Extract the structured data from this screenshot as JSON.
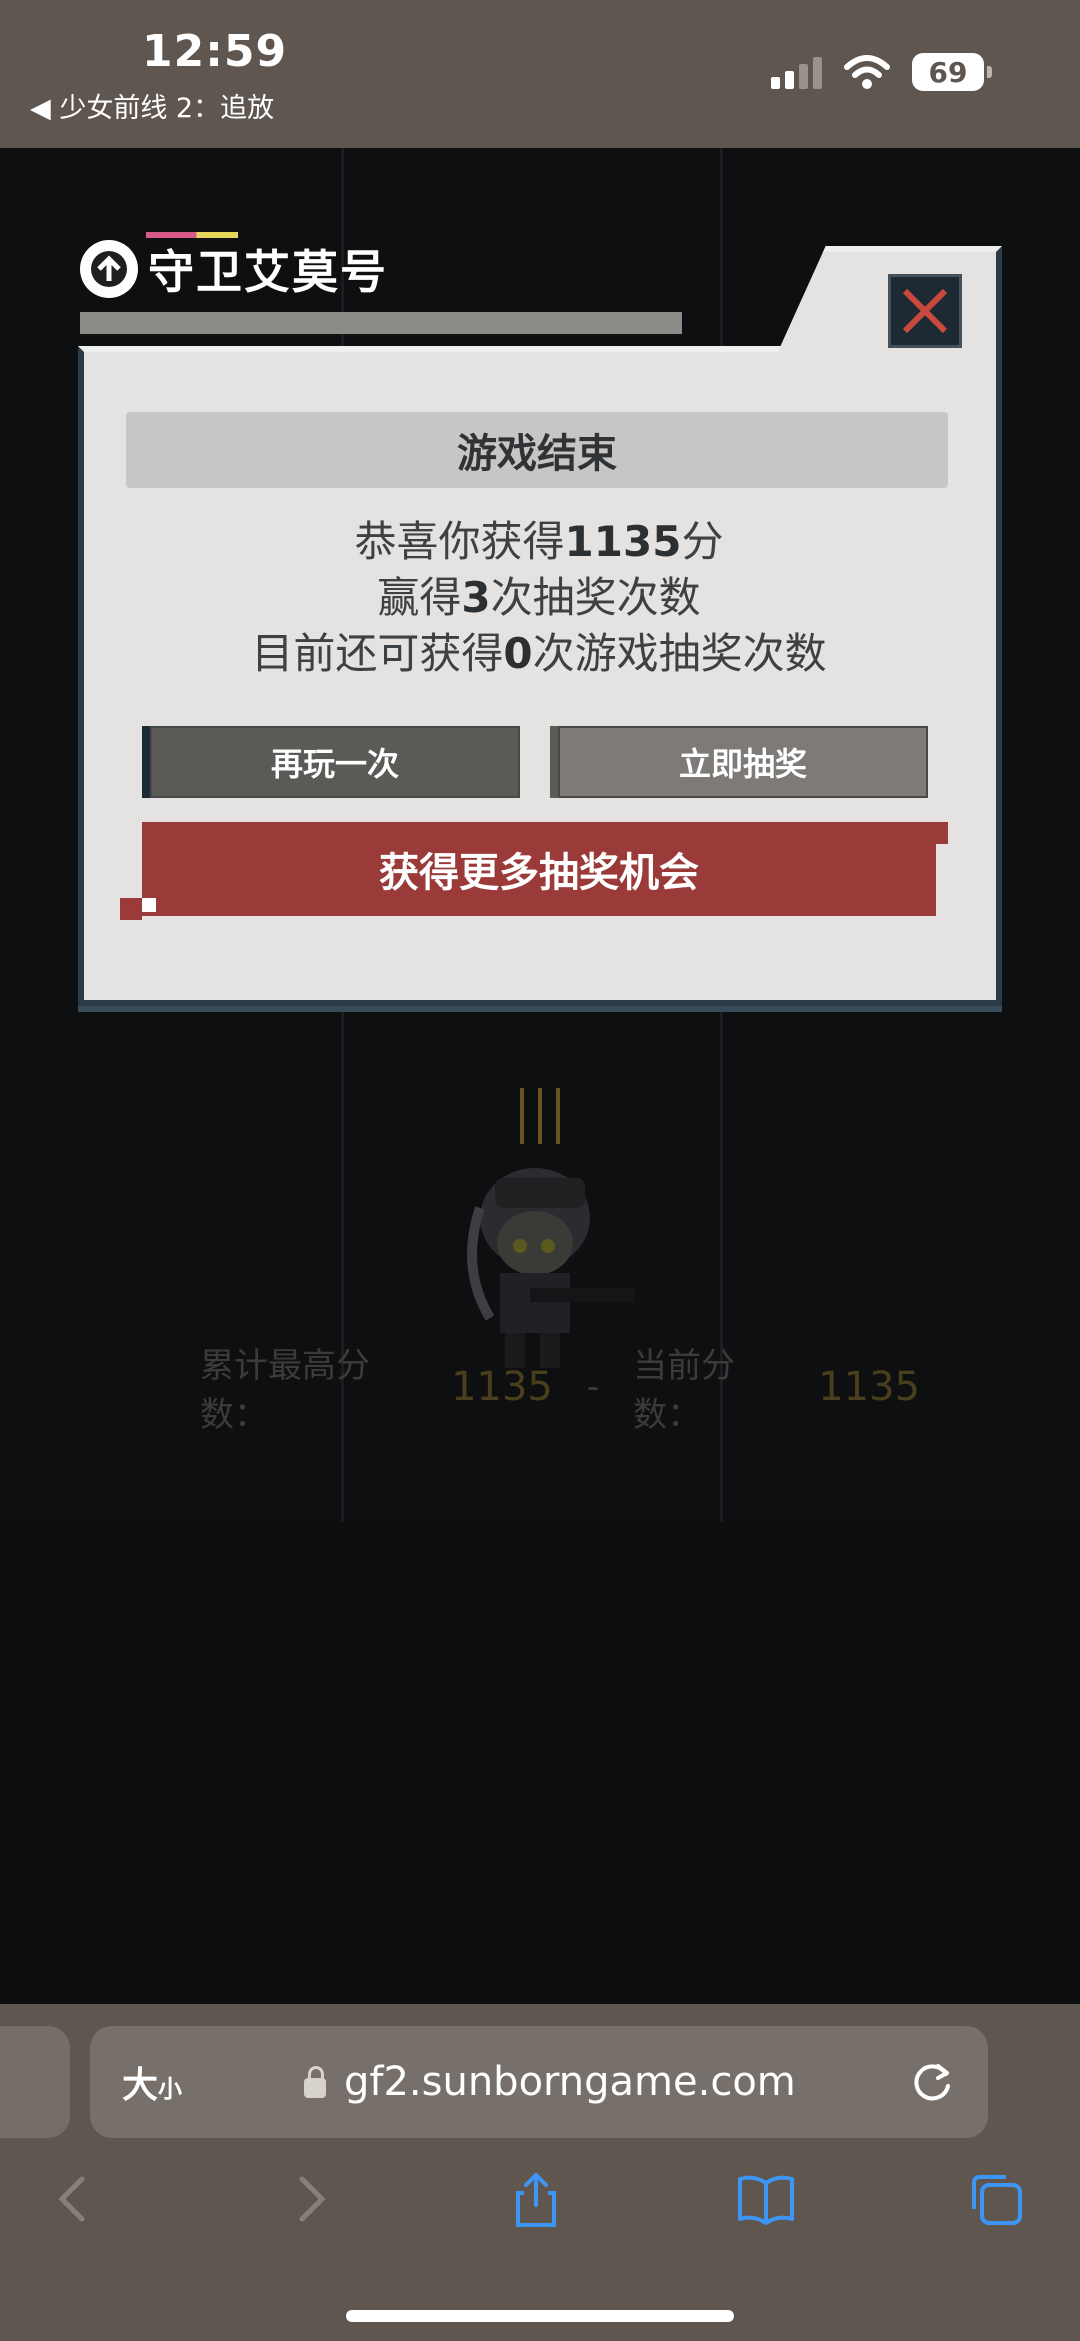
{
  "status_bar": {
    "time": "12:59",
    "back_label": "◀ 少女前线 2：追放",
    "battery": "69"
  },
  "modal": {
    "logo_title": "守卫艾莫号",
    "heading": "游戏结束",
    "line1_prefix": "恭喜你获得",
    "score": "1135",
    "line1_suffix": "分",
    "line2_prefix": "赢得",
    "draws_won": "3",
    "line2_suffix": "次抽奖次数",
    "line3_prefix": "目前还可获得",
    "draws_left": "0",
    "line3_suffix": "次游戏抽奖次数",
    "replay_label": "再玩一次",
    "draw_now_label": "立即抽奖",
    "more_chances_label": "获得更多抽奖机会",
    "colors": {
      "accent_red": "#9a3a39",
      "panel": "#e5e3e1",
      "frame": "#2a3a46"
    }
  },
  "scores": {
    "best_label": "累计最高分数：",
    "best_value": "1135",
    "separator": "-",
    "current_label": "当前分数：",
    "current_value": "1135"
  },
  "browser": {
    "text_size_label": "大",
    "text_size_small": "小",
    "url": "gf2.sunborngame.com",
    "icons": [
      "back-icon",
      "forward-icon",
      "share-icon",
      "bookmarks-icon",
      "tabs-icon",
      "reload-icon",
      "lock-icon"
    ]
  }
}
